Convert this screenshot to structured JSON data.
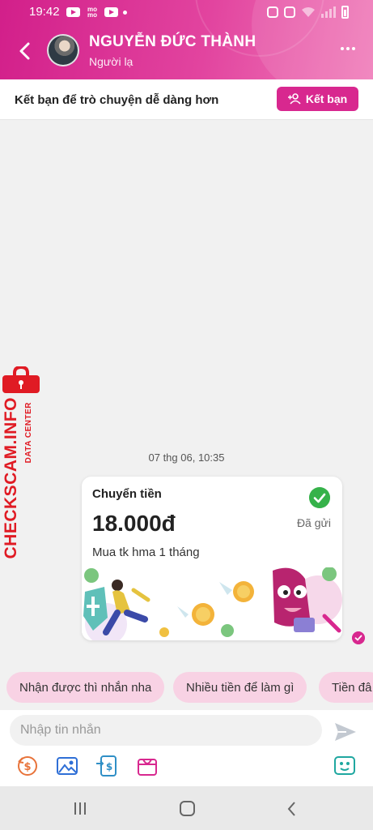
{
  "status_bar": {
    "time": "19:42",
    "momo_label": "mo\nmo"
  },
  "contact": {
    "name": "NGUYỄN ĐỨC THÀNH",
    "subtitle": "Người lạ"
  },
  "friend_bar": {
    "text": "Kết bạn để trò chuyện dễ dàng hơn",
    "button_label": "Kết bạn"
  },
  "watermark": {
    "main": "CHECKSCAM.INFO",
    "sub": "DATA CENTER"
  },
  "conversation": {
    "timestamp": "07 thg 06, 10:35",
    "transfer_card": {
      "title": "Chuyển tiền",
      "amount": "18.000đ",
      "note": "Mua tk hma 1 tháng",
      "status": "Đã gửi"
    }
  },
  "quick_replies": [
    "Nhận được thì nhắn nha",
    "Nhiều tiền để làm gì",
    "Tiền đâ"
  ],
  "composer": {
    "placeholder": "Nhập tin nhắn"
  },
  "colors": {
    "brand": "#d8288f",
    "success": "#36b24a",
    "watermark": "#e01b24"
  },
  "icons": {
    "toolbar": [
      "money-transfer-icon",
      "image-icon",
      "request-money-icon",
      "gift-icon",
      "sticker-icon"
    ]
  }
}
